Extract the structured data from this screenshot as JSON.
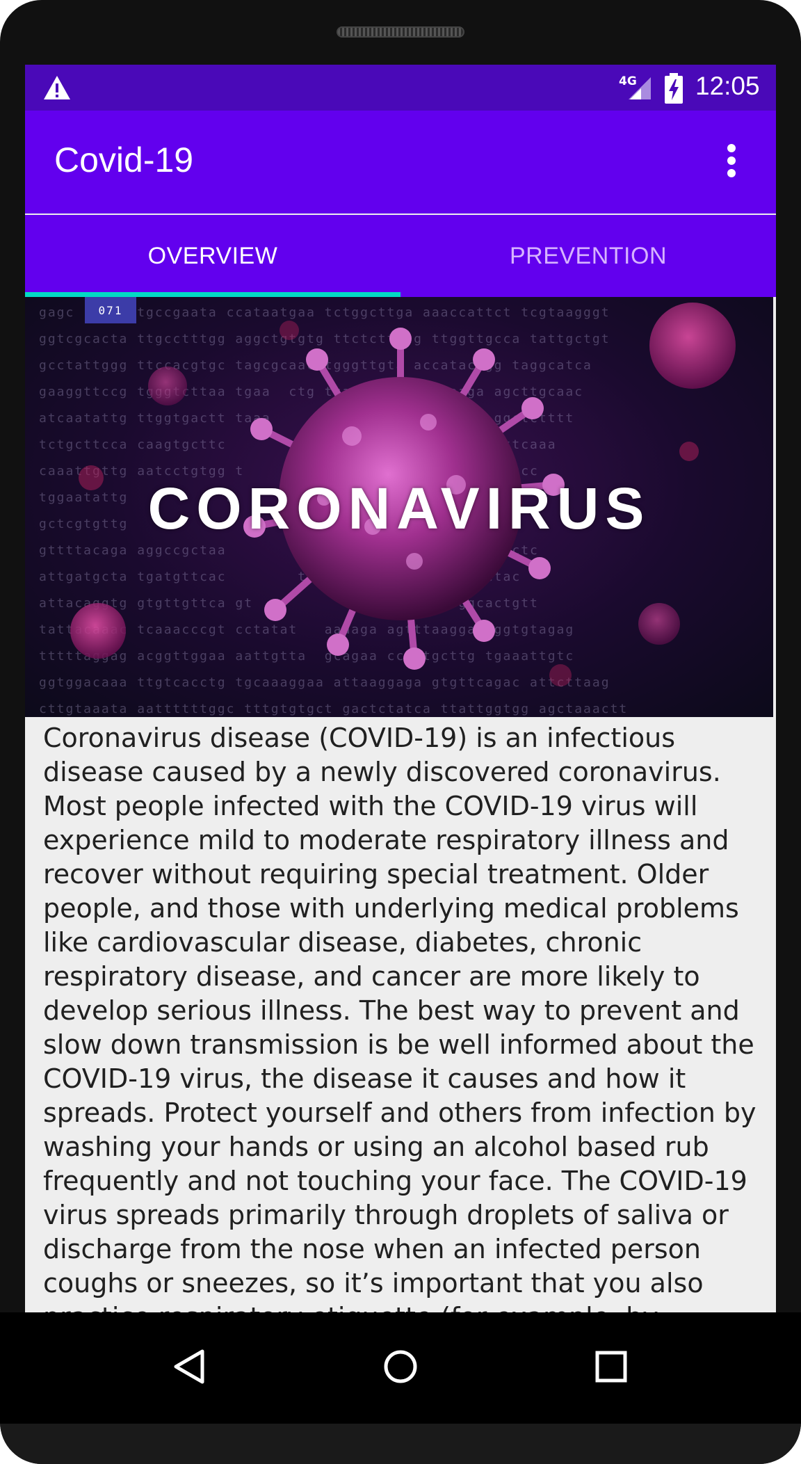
{
  "status_bar": {
    "network": "4G",
    "time": "12:05"
  },
  "app_bar": {
    "title": "Covid-19"
  },
  "tabs": [
    {
      "label": "OVERVIEW",
      "active": true
    },
    {
      "label": "PREVENTION",
      "active": false
    }
  ],
  "hero": {
    "badge": "071",
    "title": "CORONAVIRUS",
    "dna_lines": [
      "gagc    c ttgccgaata ccataatgaa tctggcttga aaaccattct tcgtaagggt",
      "ggtcgcacta ttgcctttgg aggctgtgtg ttctcttatg ttggttgcca tattgctgt",
      "gcctattggg ttccacgtgc tagcgcaac tgggttgta accatacagg taggcatca",
      "gaaggttccg tgggtcttaa tgaa  ctg tgaaat  tccaaaaaga agcttgcaac",
      "atcaatattg ttggtgactt taaa      ctaa  t ccattatttt ggctctttt",
      "tctgcttcca caagtgcttc        ggttt t tggattataa agcattcaaa",
      "caaattgttg aatcctgtgg t       tc  ga ttagctaa aaaaggtgcc",
      "tggaatattg           a          ttc gtcagaggct",
      "gctcgtgttg                               tctgcggt",
      "gttttacaga aggccgctaa        ttc   cacagtattc actgagactc",
      "attgatgcta tgatgttcac        ttc  ataagttgt aatggcctac",
      "attacaggtg gtgttgttca gt            taacatctt tggcactgtt",
      "tattacaaac tcaaacccgt cctatat   aaaaga agtttaagga aggtgtagag",
      "tttttaggag acggttggaa aattgtta  gcagaa cctgtgcttg tgaaattgtc",
      "ggtggacaaa ttgtcacctg tgcaaaggaa attaaggaga gtgttcagac attcttaag",
      "cttgtaaata aattttttggc tttgtgtgct gactctatca ttattggtgg agctaaactt"
    ]
  },
  "content": {
    "paragraph": "Coronavirus disease (COVID-19) is an infectious disease caused by a newly discovered coronavirus. Most people infected with the COVID-19 virus will experience mild to moderate respiratory illness and recover without requiring special treatment. Older people, and those with underlying medical problems like cardiovascular disease, diabetes, chronic respiratory disease, and cancer are more likely to develop serious illness. The best way to prevent and slow down transmission is be well informed about the COVID-19 virus, the disease it causes and how it spreads. Protect yourself and others from infection by washing your hands or using an alcohol based rub frequently and not touching your face. The COVID-19 virus spreads primarily through droplets of saliva or discharge from the nose when an infected person coughs or sneezes, so it’s important that you also practice respiratory etiquette (for example, by coughing into a flexed elbow)."
  },
  "colors": {
    "status_bar": "#4a09b8",
    "primary": "#6200ee",
    "tab_indicator": "#03dac5",
    "background": "#eeeeee"
  }
}
